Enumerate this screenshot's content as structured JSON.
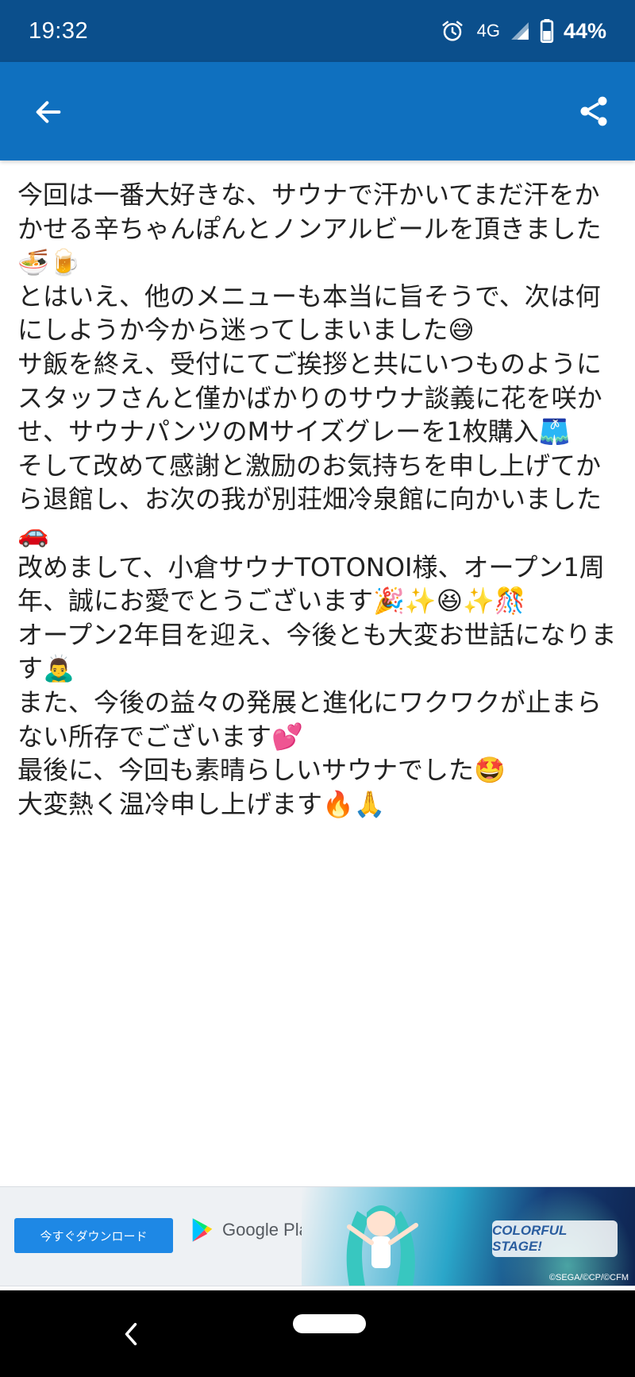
{
  "status_bar": {
    "time": "19:32",
    "network": "4G",
    "battery": "44%"
  },
  "app_bar": {
    "back_icon": "arrow-left-icon",
    "share_icon": "share-icon",
    "color": "#0f70bf"
  },
  "post": {
    "body": "今回は一番大好きな、サウナで汗かいてまだ汗をかかせる辛ちゃんぽんとノンアルビールを頂きました🍜🍺\nとはいえ、他のメニューも本当に旨そうで、次は何にしようか今から迷ってしまいました😅\nサ飯を終え、受付にてご挨拶と共にいつものようにスタッフさんと僅かばかりのサウナ談義に花を咲かせ、サウナパンツのMサイズグレーを1枚購入🩳\nそして改めて感謝と激励のお気持ちを申し上げてから退館し、お次の我が別荘畑冷泉館に向かいました🚗\n改めまして、小倉サウナTOTONOI様、オープン1周年、誠にお愛でとうございます🎉✨😆✨🎊\nオープン2年目を迎え、今後とも大変お世話になります🙇‍♂️\nまた、今後の益々の発展と進化にワクワクが止まらない所存でございます💕\n最後に、今回も素晴らしいサウナでした🤩\n大変熱く温冷申し上げます🔥🙏"
  },
  "ad": {
    "download_label": "今すぐダウンロード",
    "store_label": "Google Play",
    "logo_text": "COLORFUL STAGE!",
    "copyright": "©SEGA/©CP/©CFM"
  },
  "nav_bar": {
    "back_icon": "chevron-left-icon",
    "home_icon": "home-pill-icon"
  }
}
